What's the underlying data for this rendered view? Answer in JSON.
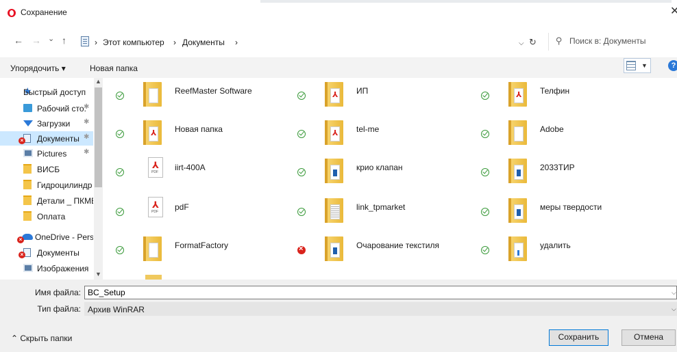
{
  "window": {
    "title": "Сохранение",
    "close_glyph": "✕"
  },
  "address": {
    "back": "←",
    "forward": "→",
    "history": "⌄",
    "up": "↑",
    "crumbs": [
      "Этот компьютер",
      "Документы"
    ],
    "separator": "›",
    "refresh": "↻",
    "search_placeholder": "Поиск в: Документы"
  },
  "toolbar": {
    "organize_label": "Упорядочить ▾",
    "new_folder_label": "Новая папка",
    "help_label": "?"
  },
  "sidebar": {
    "items": [
      {
        "label": "Быстрый доступ",
        "icon": "star-icon"
      },
      {
        "label": "Рабочий сто.",
        "icon": "desktop-icon"
      },
      {
        "label": "Загрузки",
        "icon": "downloads-icon"
      },
      {
        "label": "Документы",
        "icon": "documents-icon"
      },
      {
        "label": "Pictures",
        "icon": "pictures-icon"
      },
      {
        "label": "ВИСБ",
        "icon": "folder-icon"
      },
      {
        "label": "Гидроцилиндр",
        "icon": "folder-icon"
      },
      {
        "label": "Детали _ ПКМВ",
        "icon": "folder-icon"
      },
      {
        "label": "Оплата",
        "icon": "folder-icon"
      },
      {
        "label": "OneDrive - Persor",
        "icon": "onedrive-icon"
      },
      {
        "label": "Документы",
        "icon": "documents-icon"
      },
      {
        "label": "Изображения",
        "icon": "pictures-icon"
      }
    ]
  },
  "files": [
    {
      "name": "ReefMaster Software",
      "kind": "folder"
    },
    {
      "name": "ИП",
      "kind": "folder-pdf"
    },
    {
      "name": "Телфин",
      "kind": "folder-pdf"
    },
    {
      "name": "Новая папка",
      "kind": "folder-pdf"
    },
    {
      "name": "tel-me",
      "kind": "folder-pdf"
    },
    {
      "name": "Adobe",
      "kind": "folder"
    },
    {
      "name": "iirt-400A",
      "kind": "pdf-file"
    },
    {
      "name": "крио клапан",
      "kind": "folder-media"
    },
    {
      "name": "2033ТИР",
      "kind": "folder-media"
    },
    {
      "name": "pdF",
      "kind": "pdf-file"
    },
    {
      "name": "link_tpmarket",
      "kind": "folder-lines"
    },
    {
      "name": "меры твердости",
      "kind": "folder-media"
    },
    {
      "name": "FormatFactory",
      "kind": "folder"
    },
    {
      "name": "Очарование текстиля",
      "kind": "folder-media",
      "status": "error"
    },
    {
      "name": "удалить",
      "kind": "folder-blue"
    }
  ],
  "form": {
    "filename_label": "Имя файла:",
    "filename_value": "BC_Setup",
    "filetype_label": "Тип файла:",
    "filetype_value": "Архив WinRAR",
    "hide_folders_label": "⌃ Скрыть папки",
    "save_label": "Сохранить",
    "cancel_label": "Отмена"
  }
}
